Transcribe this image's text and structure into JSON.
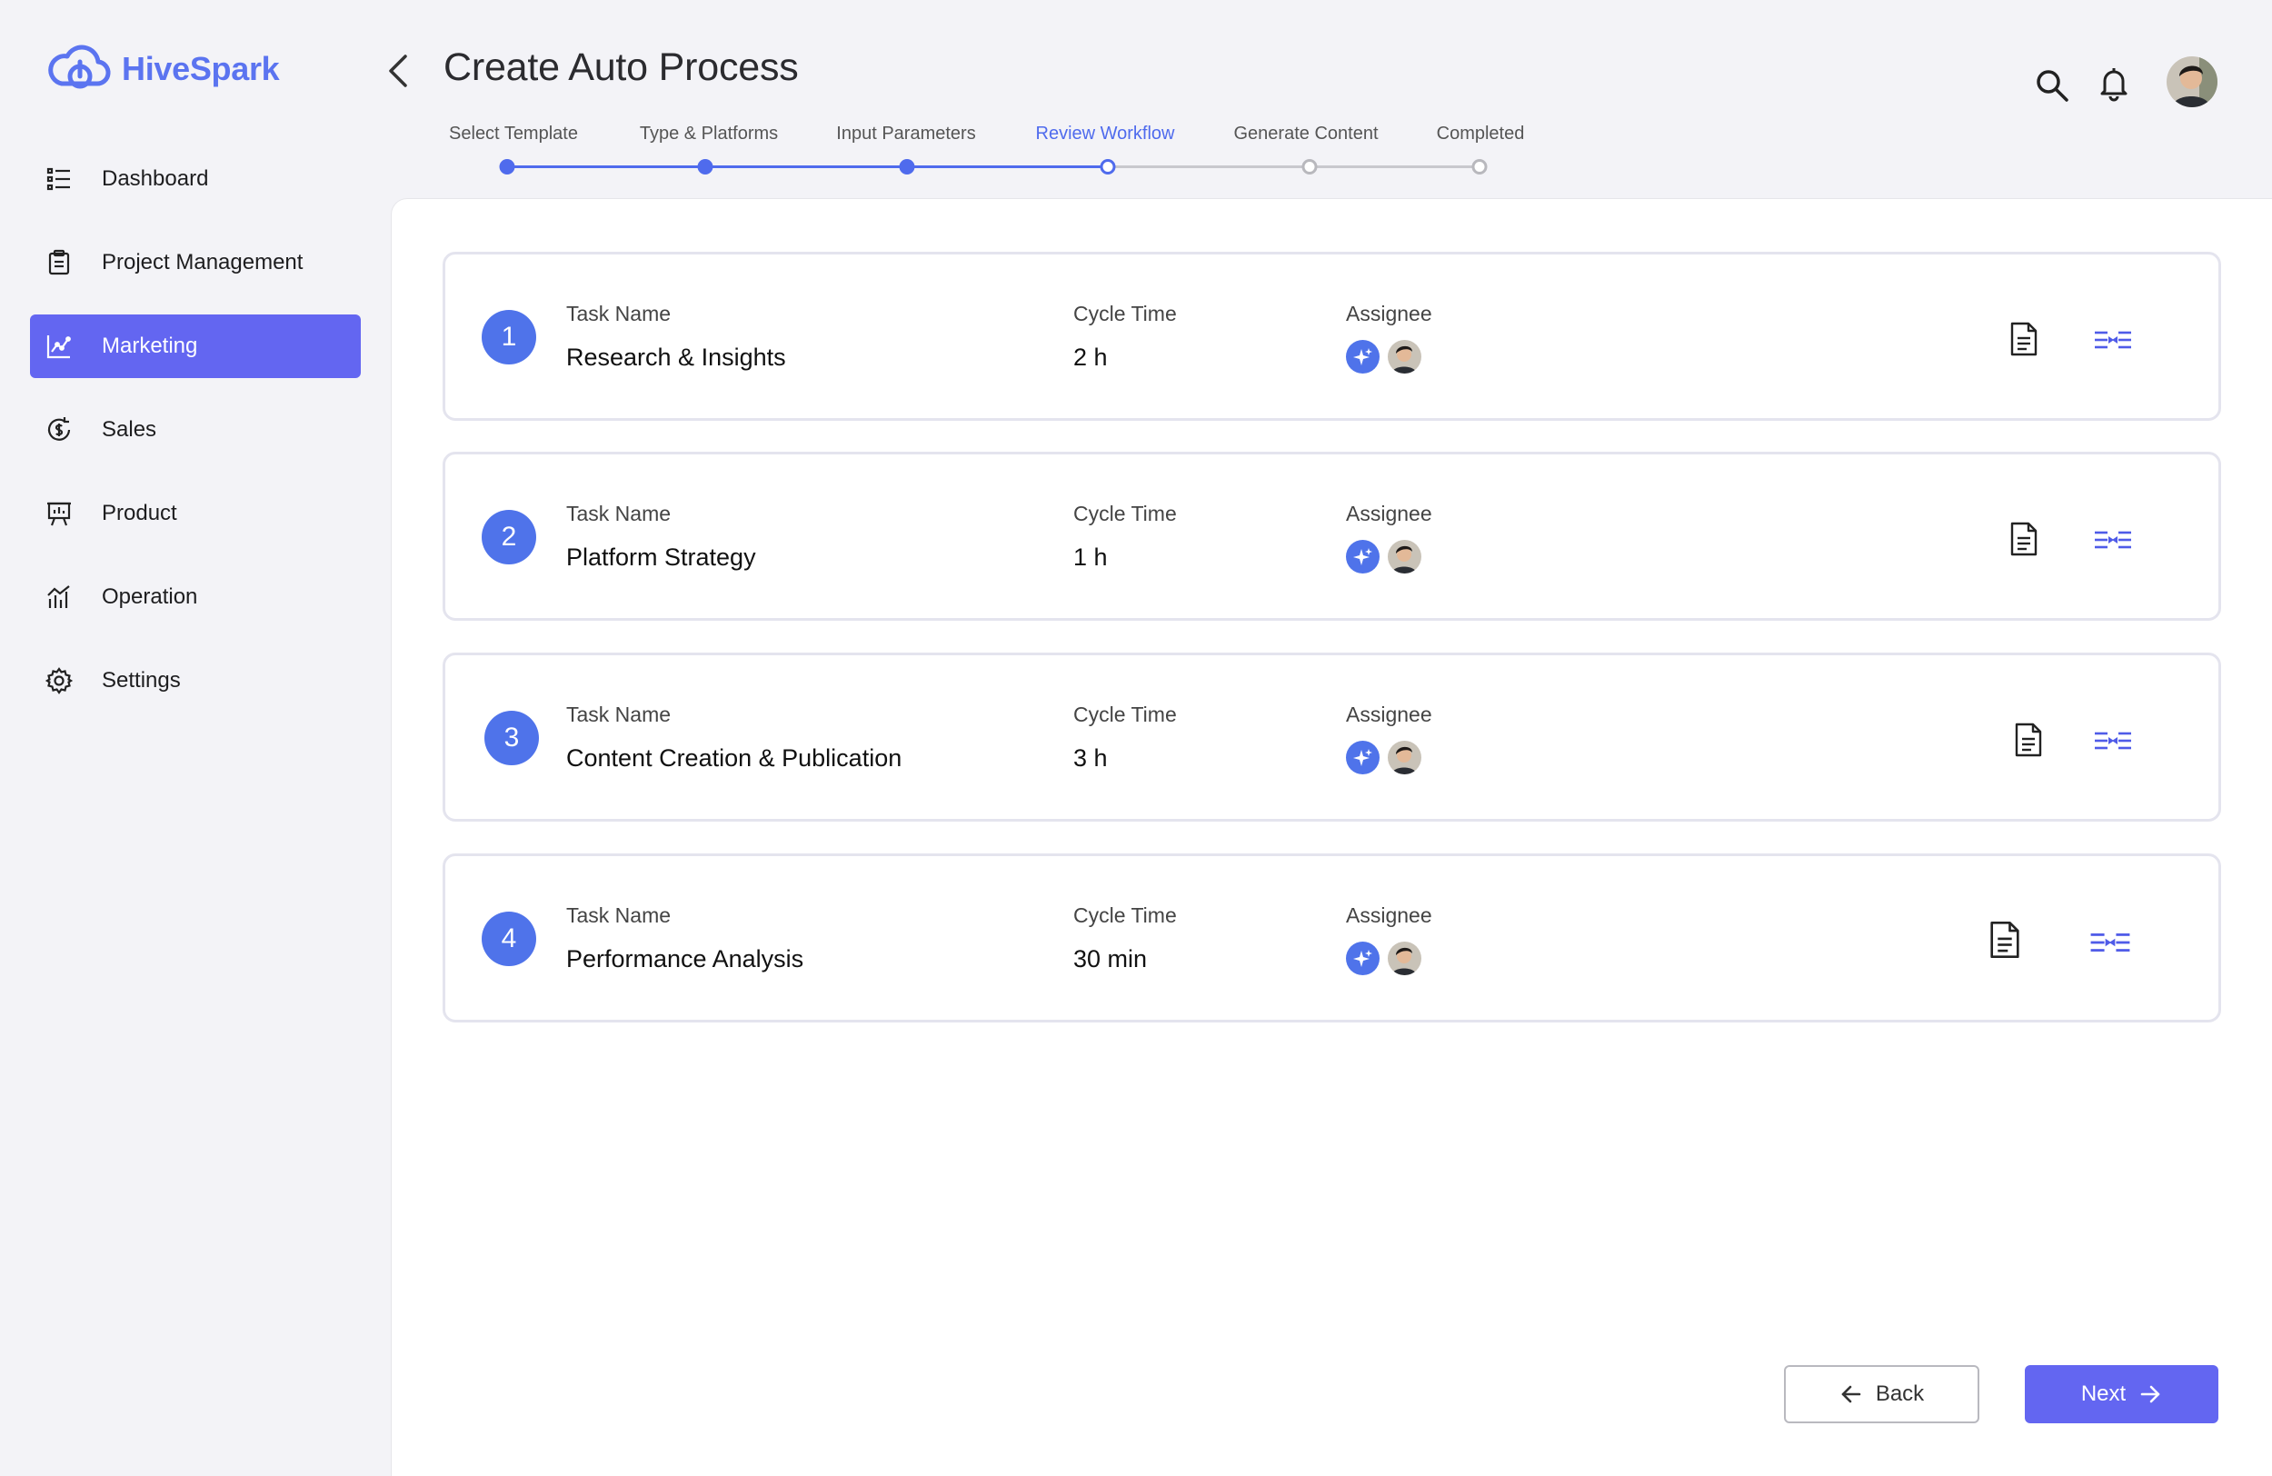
{
  "app": {
    "name": "HiveSpark",
    "brand_color": "#5b74f0",
    "accent_color": "#6366f1"
  },
  "sidebar": {
    "items": [
      {
        "label": "Dashboard",
        "icon": "list-icon",
        "active": false
      },
      {
        "label": "Project Management",
        "icon": "clipboard-icon",
        "active": false
      },
      {
        "label": "Marketing",
        "icon": "trend-chart-icon",
        "active": true
      },
      {
        "label": "Sales",
        "icon": "dollar-cycle-icon",
        "active": false
      },
      {
        "label": "Product",
        "icon": "presentation-board-icon",
        "active": false
      },
      {
        "label": "Operation",
        "icon": "bar-trend-icon",
        "active": false
      },
      {
        "label": "Settings",
        "icon": "gear-icon",
        "active": false
      }
    ]
  },
  "header": {
    "title": "Create Auto Process",
    "back_icon": "chevron-left-icon",
    "search_icon": "search-icon",
    "notification_icon": "bell-icon"
  },
  "stepper": {
    "steps": [
      {
        "label": "Select Template",
        "state": "done"
      },
      {
        "label": "Type & Platforms",
        "state": "done"
      },
      {
        "label": "Input Parameters",
        "state": "done"
      },
      {
        "label": "Review Workflow",
        "state": "current"
      },
      {
        "label": "Generate Content",
        "state": "todo"
      },
      {
        "label": "Completed",
        "state": "todo"
      }
    ]
  },
  "tasks": {
    "headers": {
      "task_name": "Task Name",
      "cycle_time": "Cycle Time",
      "assignee": "Assignee"
    },
    "items": [
      {
        "number": "1",
        "name": "Research & Insights",
        "cycle_time": "2 h"
      },
      {
        "number": "2",
        "name": "Platform Strategy",
        "cycle_time": "1 h"
      },
      {
        "number": "3",
        "name": "Content Creation & Publication",
        "cycle_time": "3 h"
      },
      {
        "number": "4",
        "name": "Performance Analysis",
        "cycle_time": "30 min"
      }
    ]
  },
  "footer": {
    "back_label": "Back",
    "next_label": "Next"
  }
}
